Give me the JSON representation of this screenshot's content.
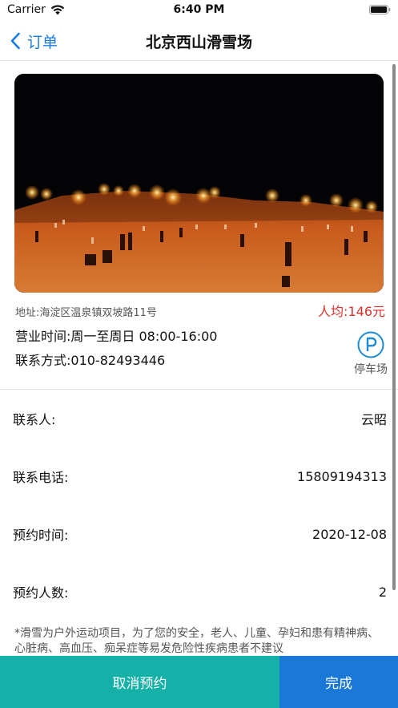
{
  "status_bar": {
    "carrier": "Carrier",
    "time": "6:40 PM"
  },
  "nav": {
    "back_label": "订单",
    "title": "北京西山滑雪场"
  },
  "venue": {
    "photo_description_icon": "ski-slope-night-photo",
    "address": "地址:海淀区温泉镇双坡路11号",
    "price_label": "人均:",
    "price_value": "146元",
    "hours": "营业时间:周一至周日 08:00-16:00",
    "contact": "联系方式:010-82493446",
    "parking_label": "停车场"
  },
  "details": [
    {
      "label": "联系人:",
      "value": "云昭"
    },
    {
      "label": "联系电话:",
      "value": "15809194313"
    },
    {
      "label": "预约时间:",
      "value": "2020-12-08"
    },
    {
      "label": "预约人数:",
      "value": "2"
    }
  ],
  "notice": "*滑雪为户外运动项目，为了您的安全，老人、儿童、孕妇和患有精神病、心脏病、高血压、痴呆症等易发危险性疾病患者不建议",
  "buttons": {
    "cancel": "取消预约",
    "done": "完成"
  },
  "colors": {
    "accent_blue": "#1a7be0",
    "price_red": "#d9322b",
    "cancel_teal": "#15b0a8",
    "done_blue": "#1a78d6"
  }
}
